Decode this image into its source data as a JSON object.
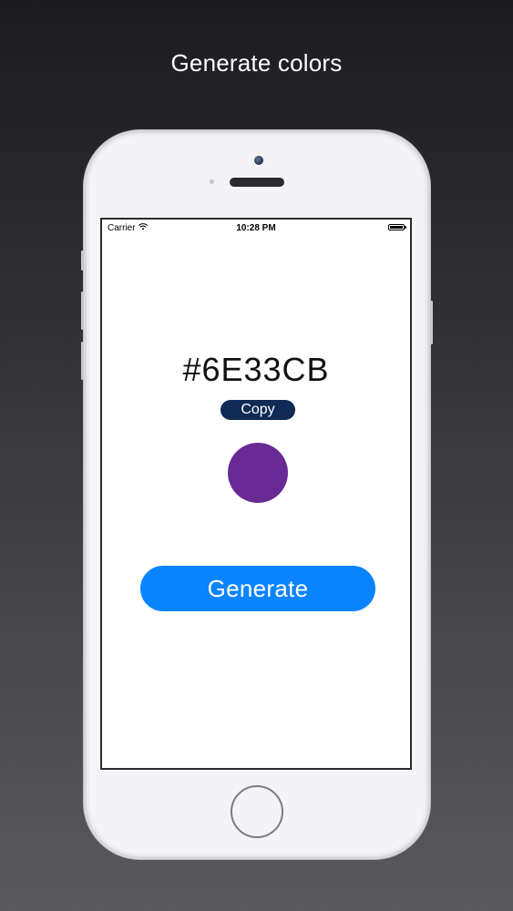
{
  "headline": "Generate colors",
  "status_bar": {
    "carrier": "Carrier",
    "wifi_icon": "wifi-icon",
    "time": "10:28 PM",
    "battery_icon": "battery-icon",
    "battery_level": 1.0
  },
  "app": {
    "hex_value": "#6E33CB",
    "copy_label": "Copy",
    "swatch_color": "#6a2a96",
    "generate_label": "Generate"
  },
  "colors": {
    "copy_button": "#0f2a55",
    "generate_button": "#0a84ff",
    "screen_background": "#ffffff"
  }
}
